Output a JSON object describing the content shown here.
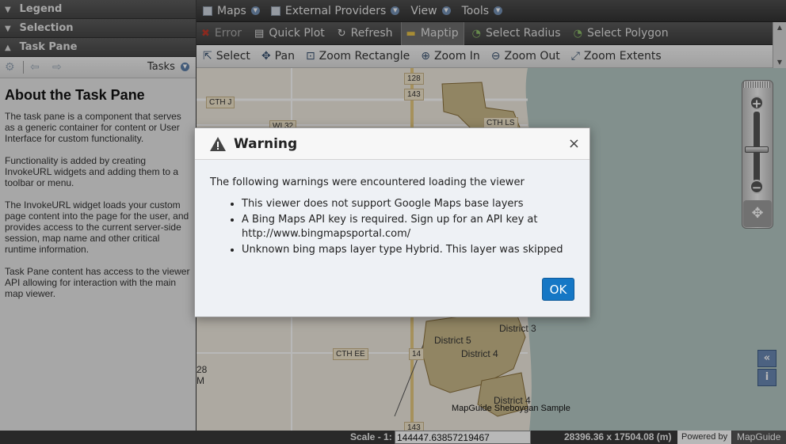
{
  "left_panel": {
    "sections": [
      {
        "label": "Legend",
        "state": "collapsed"
      },
      {
        "label": "Selection",
        "state": "collapsed"
      },
      {
        "label": "Task Pane",
        "state": "expanded"
      }
    ],
    "task_toolbar": {
      "menu_label": "Tasks"
    },
    "task_content": {
      "title": "About the Task Pane",
      "paragraphs": [
        "The task pane is a component that serves as a generic container for content or User Interface for custom functionality.",
        "Functionality is added by creating InvokeURL widgets and adding them to a toolbar or menu.",
        "The InvokeURL widget loads your custom page content into the page for the user, and provides access to the current server-side session, map name and other critical runtime information.",
        "Task Pane content has access to the viewer API allowing for interaction with the main map viewer."
      ]
    }
  },
  "menubar": {
    "items": [
      {
        "label": "Maps",
        "icon": "map-icon"
      },
      {
        "label": "External Providers",
        "icon": "layers-icon"
      },
      {
        "label": "View",
        "icon": "view-icon"
      },
      {
        "label": "Tools",
        "icon": "tools-icon"
      }
    ]
  },
  "toolbar2": {
    "items": [
      {
        "label": "Error",
        "icon": "error-icon",
        "state": "disabled"
      },
      {
        "label": "Quick Plot",
        "icon": "printer-icon"
      },
      {
        "label": "Refresh",
        "icon": "refresh-icon"
      },
      {
        "label": "Maptip",
        "icon": "maptip-icon",
        "state": "active"
      },
      {
        "label": "Select Radius",
        "icon": "select-radius-icon"
      },
      {
        "label": "Select Polygon",
        "icon": "select-polygon-icon"
      }
    ]
  },
  "toolbar3": {
    "items": [
      {
        "label": "Select",
        "icon": "cursor-icon"
      },
      {
        "label": "Pan",
        "icon": "pan-hand-icon"
      },
      {
        "label": "Zoom Rectangle",
        "icon": "zoom-rectangle-icon"
      },
      {
        "label": "Zoom In",
        "icon": "zoom-in-icon"
      },
      {
        "label": "Zoom Out",
        "icon": "zoom-out-icon"
      },
      {
        "label": "Zoom Extents",
        "icon": "zoom-extents-icon"
      }
    ]
  },
  "map": {
    "labels": {
      "cth_j": "CTH J",
      "wi_32": "WI 32",
      "cth_ls": "CTH LS",
      "r128": "128",
      "r143_top": "143",
      "r143_bottom": "143",
      "district3": "District 3",
      "district5": "District 5",
      "district4a": "District 4",
      "district4b": "District 4",
      "cth_ee": "CTH EE",
      "r14": "14",
      "edge_28": "28",
      "edge_m": "M"
    },
    "footer_text": "MapGuide Sheboygan Sample",
    "colors": {
      "water": "#b5c8c4",
      "land": "#f0ebe0",
      "district": "#c9b98a"
    }
  },
  "statusbar": {
    "scale_label": "Scale - 1:",
    "scale_value": "144447.63857219467",
    "coords": "28396.36 x 17504.08 (m)",
    "powered_by": "Powered by",
    "brand": "MapGuide"
  },
  "dialog": {
    "title": "Warning",
    "close_glyph": "×",
    "intro": "The following warnings were encountered loading the viewer",
    "warnings": [
      "This viewer does not support Google Maps base layers",
      "A Bing Maps API key is required. Sign up for an API key at http://www.bingmapsportal.com/",
      "Unknown bing maps layer type Hybrid. This layer was skipped"
    ],
    "ok_label": "OK"
  }
}
